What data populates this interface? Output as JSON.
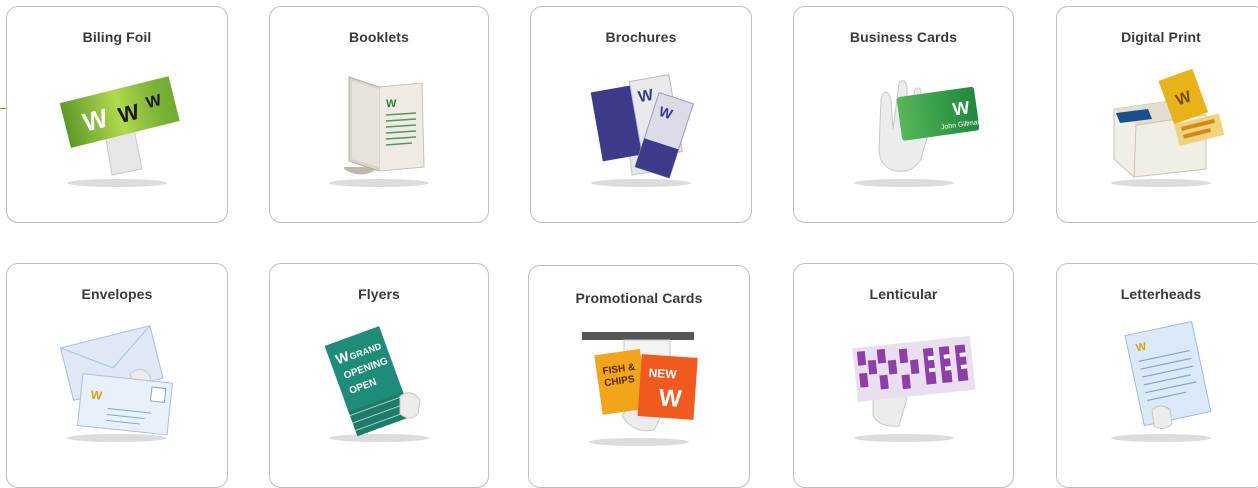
{
  "products": [
    {
      "label": "Biling Foil",
      "icon": "foil-cards-hand-icon"
    },
    {
      "label": "Booklets",
      "icon": "booklet-icon"
    },
    {
      "label": "Brochures",
      "icon": "brochures-hand-icon"
    },
    {
      "label": "Business Cards",
      "icon": "business-card-hand-icon"
    },
    {
      "label": "Digital Print",
      "icon": "printer-icon"
    },
    {
      "label": "Envelopes",
      "icon": "envelopes-hand-icon"
    },
    {
      "label": "Flyers",
      "icon": "flyers-stack-hand-icon"
    },
    {
      "label": "Promotional Cards",
      "icon": "promotional-cards-hand-icon"
    },
    {
      "label": "Lenticular",
      "icon": "lenticular-card-hand-icon"
    },
    {
      "label": "Letterheads",
      "icon": "letterhead-hand-icon"
    }
  ],
  "colors": {
    "accent": "#6aa82e",
    "card_border": "#bfbfbf",
    "title_text": "#3a3a3a"
  }
}
